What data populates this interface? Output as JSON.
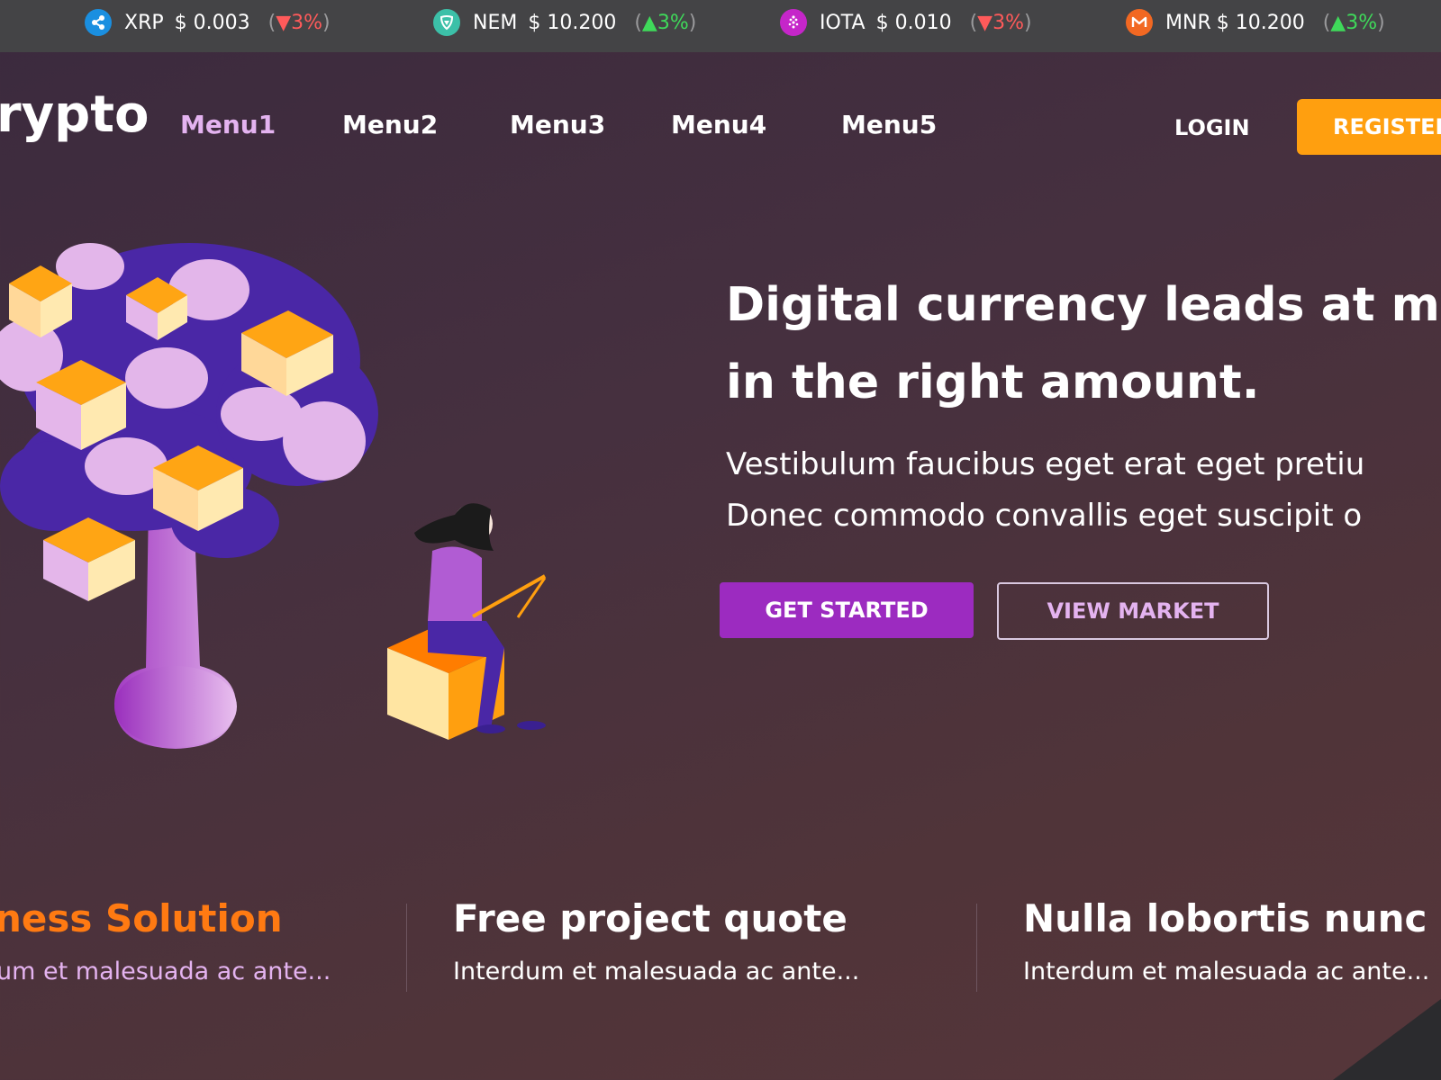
{
  "ticker": [
    {
      "symbol": "XRP",
      "price": "$ 0.003",
      "change": "▼3%",
      "direction": "down",
      "icon": "xrp-icon",
      "color": "#1a8fe0"
    },
    {
      "symbol": "NEM",
      "price": "$ 10.200",
      "change": "▲3%",
      "direction": "up",
      "icon": "nem-icon",
      "color": "#3cc0a8"
    },
    {
      "symbol": "IOTA",
      "price": "$ 0.010",
      "change": "▼3%",
      "direction": "down",
      "icon": "iota-icon",
      "color": "#c526c9"
    },
    {
      "symbol": "MNR",
      "price": "$ 10.200",
      "change": "▲3%",
      "direction": "up",
      "icon": "monero-icon",
      "color": "#f26822"
    }
  ],
  "brand": {
    "logo_text": "rypto"
  },
  "nav": {
    "menus": [
      "Menu1",
      "Menu2",
      "Menu3",
      "Menu4",
      "Menu5"
    ],
    "active_menu": "Menu1",
    "login_label": "LOGIN",
    "register_label": "REGISTER"
  },
  "hero": {
    "headline_line1": "Digital currency leads at ma",
    "headline_line2": "in the right amount.",
    "sub_line1": "Vestibulum faucibus eget erat eget pretiu",
    "sub_line2": "Donec commodo convallis eget suscipit o",
    "primary_button": "GET STARTED",
    "secondary_button": "VIEW MARKET"
  },
  "features": [
    {
      "title": "ness Solution",
      "desc": "um et malesuada ac ante..."
    },
    {
      "title": "Free project quote",
      "desc": "Interdum et malesuada ac ante..."
    },
    {
      "title": "Nulla lobortis nunc",
      "desc": "Interdum et malesuada ac ante..."
    }
  ],
  "colors": {
    "accent_orange": "#ff9f0f",
    "accent_purple": "#9c2bc0",
    "menu_active": "#e4b3f0",
    "feature_highlight": "#ff7a12"
  }
}
